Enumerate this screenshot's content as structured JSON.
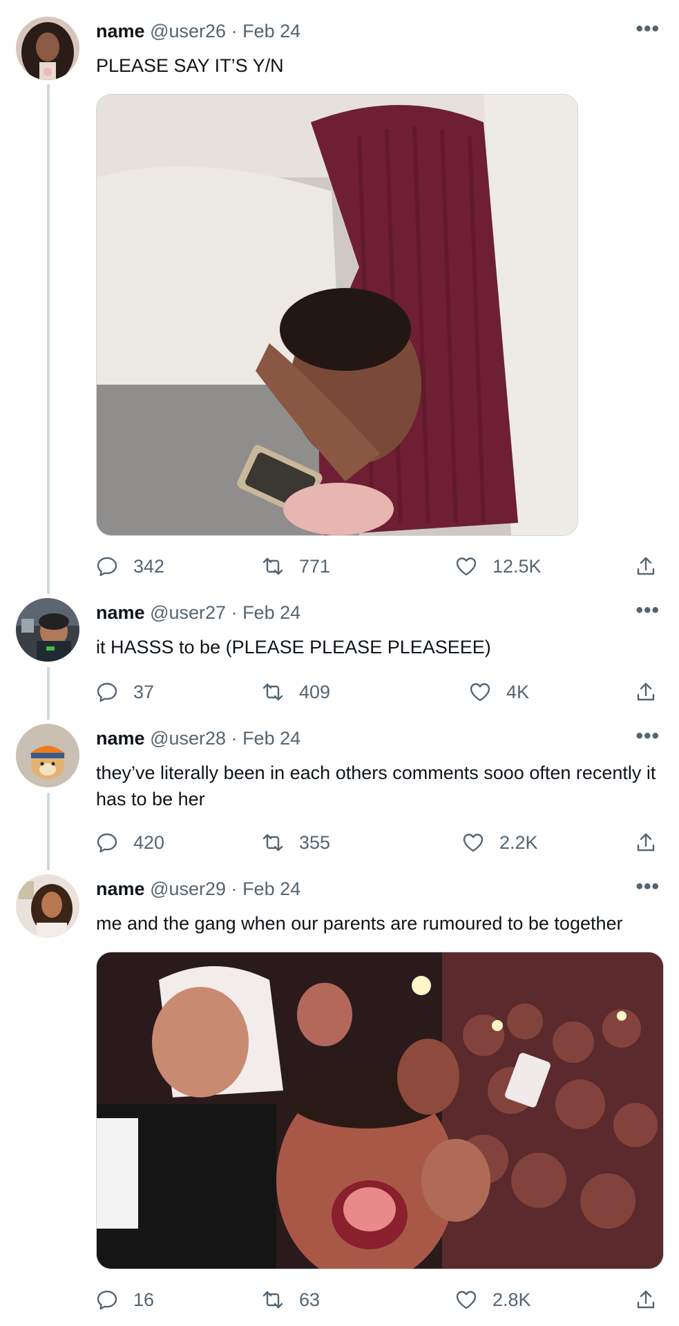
{
  "tweets": [
    {
      "name": "name",
      "handle": "@user26",
      "separator": "·",
      "date": "Feb 24",
      "text": "PLEASE SAY IT’S Y/N",
      "has_media": true,
      "replies": "342",
      "retweets": "771",
      "likes": "12.5K",
      "more": "•••"
    },
    {
      "name": "name",
      "handle": "@user27",
      "separator": "·",
      "date": "Feb 24",
      "text": "it HASSS to be (PLEASE PLEASE PLEASEEE)",
      "has_media": false,
      "replies": "37",
      "retweets": "409",
      "likes": "4K",
      "more": "•••"
    },
    {
      "name": "name",
      "handle": "@user28",
      "separator": "·",
      "date": "Feb 24",
      "text": "they’ve literally been in each others comments sooo often recently it has to be her",
      "has_media": false,
      "replies": "420",
      "retweets": "355",
      "likes": "2.2K",
      "more": "•••"
    },
    {
      "name": "name",
      "handle": "@user29",
      "separator": "·",
      "date": "Feb 24",
      "text": "me and the gang when our parents are rumoured to be together",
      "has_media": true,
      "replies": "16",
      "retweets": "63",
      "likes": "2.8K",
      "more": "•••"
    }
  ],
  "icons": {
    "reply": "reply-icon",
    "retweet": "retweet-icon",
    "like": "heart-icon",
    "share": "share-icon",
    "more": "more-icon"
  },
  "colors": {
    "text_primary": "#0f1419",
    "text_secondary": "#536471",
    "thread_line": "#cfd9de"
  }
}
